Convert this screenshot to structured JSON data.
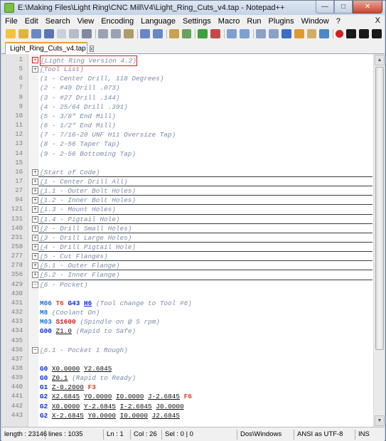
{
  "window": {
    "title": "E:\\Making Files\\Light Ring\\CNC Mill\\V4\\Light_Ring_Cuts_v4.tap - Notepad++",
    "minimize": "—",
    "maximize": "□",
    "close": "✕"
  },
  "menu": {
    "items": [
      "File",
      "Edit",
      "Search",
      "View",
      "Encoding",
      "Language",
      "Settings",
      "Macro",
      "Run",
      "Plugins",
      "Window",
      "?"
    ],
    "close_glyph": "X"
  },
  "toolbar": {
    "icons": [
      "new-file-icon",
      "open-file-icon",
      "save-icon",
      "save-all-icon",
      "close-icon",
      "close-all-icon",
      "print-icon",
      "cut-icon",
      "copy-icon",
      "paste-icon",
      "undo-icon",
      "redo-icon",
      "find-icon",
      "replace-icon",
      "zoom-in-icon",
      "zoom-out-icon",
      "sync-v-icon",
      "sync-h-icon",
      "wrap-icon",
      "all-chars-icon",
      "indent-guide-icon",
      "udl-icon",
      "doc-map-icon",
      "function-list-icon",
      "record-macro-icon",
      "stop-macro-icon",
      "play-macro-icon",
      "play-multiple-icon"
    ],
    "colors": [
      "#f4c242",
      "#e3b23c",
      "#6a86c4",
      "#5a76b4",
      "#c9d0dc",
      "#b4bcc9",
      "#7f8aa0",
      "#9aa3b3",
      "#9aa3b3",
      "#b09c6a",
      "#6a86c4",
      "#6a86c4",
      "#c9a24a",
      "#6aa060",
      "#3f9f3f",
      "#c44a4a",
      "#7f9fd0",
      "#7f9fd0",
      "#8aa0c8",
      "#8aa0c8",
      "#3c6ec4",
      "#e09a30",
      "#d0b060",
      "#4a88c8",
      "#d22020",
      "#1a1a1a",
      "#1a1a1a",
      "#1a1a1a"
    ]
  },
  "tab": {
    "label": "Light_Ring_Cuts_v4.tap",
    "close": "x"
  },
  "editor": {
    "lines": [
      {
        "n": "1",
        "fold": "red",
        "segs": [
          {
            "c": "cm-u",
            "t": "("
          },
          {
            "c": "cm",
            "t": "Light Ring Version 4.2)"
          }
        ],
        "box": true
      },
      {
        "n": "5",
        "fold": "plus",
        "segs": [
          {
            "c": "cm-u",
            "t": "("
          },
          {
            "c": "cm",
            "t": "Tool List)"
          }
        ]
      },
      {
        "n": "6",
        "segs": [
          {
            "c": "cm",
            "t": "(1 - Center Drill, 118 Degrees)"
          }
        ]
      },
      {
        "n": "7",
        "segs": [
          {
            "c": "cm",
            "t": "(2 - #49 Drill .073)"
          }
        ]
      },
      {
        "n": "8",
        "segs": [
          {
            "c": "cm",
            "t": "(3 - #27 Drill .144)"
          }
        ]
      },
      {
        "n": "9",
        "segs": [
          {
            "c": "cm",
            "t": "(4 - 25/64 Drill .391)"
          }
        ]
      },
      {
        "n": "10",
        "segs": [
          {
            "c": "cm",
            "t": "(5 - 3/8\" End Mill)"
          }
        ]
      },
      {
        "n": "11",
        "segs": [
          {
            "c": "cm",
            "t": "(6 - 1/2\" End Mill)"
          }
        ]
      },
      {
        "n": "12",
        "segs": [
          {
            "c": "cm",
            "t": "(7 - 7/16-20 UNF H11 Oversize Tap)"
          }
        ]
      },
      {
        "n": "13",
        "segs": [
          {
            "c": "cm",
            "t": "(8 - 2-56 Taper Tap)"
          }
        ]
      },
      {
        "n": "14",
        "segs": [
          {
            "c": "cm",
            "t": "(9 - 2-56 Bottoming Tap)"
          }
        ]
      },
      {
        "n": "15",
        "segs": []
      },
      {
        "n": "16",
        "fold": "plus",
        "segs": [
          {
            "c": "cm-u",
            "t": "("
          },
          {
            "c": "cm",
            "t": "Start of Code)"
          }
        ],
        "sep": true
      },
      {
        "n": "17",
        "fold": "plus",
        "segs": [
          {
            "c": "cm-u",
            "t": "("
          },
          {
            "c": "cm",
            "t": "1 - Center Drill All)"
          }
        ],
        "sep": true
      },
      {
        "n": "27",
        "fold": "plus",
        "segs": [
          {
            "c": "cm-u",
            "t": "("
          },
          {
            "c": "cm",
            "t": "1.1 - Outer Bolt Holes)"
          }
        ],
        "sep": true
      },
      {
        "n": "94",
        "fold": "plus",
        "segs": [
          {
            "c": "cm-u",
            "t": "("
          },
          {
            "c": "cm",
            "t": "1.2 - Inner Bolt Holes)"
          }
        ],
        "sep": true
      },
      {
        "n": "121",
        "fold": "plus",
        "segs": [
          {
            "c": "cm-u",
            "t": "("
          },
          {
            "c": "cm",
            "t": "1.3 - Mount Holes)"
          }
        ],
        "sep": true
      },
      {
        "n": "131",
        "fold": "plus",
        "segs": [
          {
            "c": "cm-u",
            "t": "("
          },
          {
            "c": "cm",
            "t": "1.4 - Pigtail Hole)"
          }
        ],
        "sep": true
      },
      {
        "n": "140",
        "fold": "plus",
        "segs": [
          {
            "c": "cm-u",
            "t": "("
          },
          {
            "c": "cm",
            "t": "2 - Drill Small Holes)"
          }
        ],
        "sep": true
      },
      {
        "n": "231",
        "fold": "plus",
        "segs": [
          {
            "c": "cm-u",
            "t": "("
          },
          {
            "c": "cm",
            "t": "3 - Drill Large Holes)"
          }
        ],
        "sep": true
      },
      {
        "n": "258",
        "fold": "plus",
        "segs": [
          {
            "c": "cm-u",
            "t": "("
          },
          {
            "c": "cm",
            "t": "4 - Drill Pigtail Hole)"
          }
        ],
        "sep": true
      },
      {
        "n": "277",
        "fold": "plus",
        "segs": [
          {
            "c": "cm-u",
            "t": "("
          },
          {
            "c": "cm",
            "t": "5 - Cut Flanges)"
          }
        ],
        "sep": true
      },
      {
        "n": "278",
        "fold": "plus",
        "segs": [
          {
            "c": "cm-u",
            "t": "("
          },
          {
            "c": "cm",
            "t": "5.1 - Outer Flange)"
          }
        ],
        "sep": true
      },
      {
        "n": "356",
        "fold": "plus",
        "segs": [
          {
            "c": "cm-u",
            "t": "("
          },
          {
            "c": "cm",
            "t": "5.2 - Inner Flange)"
          }
        ],
        "sep": true
      },
      {
        "n": "429",
        "fold": "minus",
        "segs": [
          {
            "c": "cm-u",
            "t": "("
          },
          {
            "c": "cm",
            "t": "6 - Pocket)"
          }
        ]
      },
      {
        "n": "430",
        "segs": []
      },
      {
        "n": "431",
        "segs": [
          {
            "c": "kw-m",
            "t": "M06"
          },
          {
            "c": "plain",
            "t": " "
          },
          {
            "c": "kw-t",
            "t": "T6"
          },
          {
            "c": "plain",
            "t": " "
          },
          {
            "c": "kw-g",
            "t": "G43"
          },
          {
            "c": "plain",
            "t": " "
          },
          {
            "c": "kw-h",
            "t": "H6"
          },
          {
            "c": "plain",
            "t": " "
          },
          {
            "c": "cm",
            "t": "(Tool change to Tool #6)"
          }
        ]
      },
      {
        "n": "432",
        "segs": [
          {
            "c": "kw-m",
            "t": "M8"
          },
          {
            "c": "plain",
            "t": " "
          },
          {
            "c": "cm",
            "t": "(Coolant On)"
          }
        ]
      },
      {
        "n": "433",
        "segs": [
          {
            "c": "kw-m",
            "t": "M03"
          },
          {
            "c": "plain",
            "t": " "
          },
          {
            "c": "kw-s",
            "t": "S1600"
          },
          {
            "c": "plain",
            "t": " "
          },
          {
            "c": "cm",
            "t": "(Spindle on @ S rpm)"
          }
        ]
      },
      {
        "n": "434",
        "segs": [
          {
            "c": "kw-g",
            "t": "G00"
          },
          {
            "c": "plain",
            "t": " "
          },
          {
            "c": "num-u",
            "t": "Z1.0"
          },
          {
            "c": "plain",
            "t": " "
          },
          {
            "c": "cm",
            "t": "(Rapid to Safe)"
          }
        ]
      },
      {
        "n": "435",
        "segs": []
      },
      {
        "n": "436",
        "fold": "minus",
        "segs": [
          {
            "c": "cm-u",
            "t": "("
          },
          {
            "c": "cm",
            "t": "6.1 - Pocket 1 Rough)"
          }
        ]
      },
      {
        "n": "437",
        "segs": []
      },
      {
        "n": "438",
        "segs": [
          {
            "c": "kw-g",
            "t": "G0"
          },
          {
            "c": "plain",
            "t": " "
          },
          {
            "c": "num-u",
            "t": "X0.0000"
          },
          {
            "c": "plain",
            "t": " "
          },
          {
            "c": "num-u",
            "t": "Y2.6845"
          }
        ]
      },
      {
        "n": "439",
        "segs": [
          {
            "c": "kw-g",
            "t": "G0"
          },
          {
            "c": "plain",
            "t": " "
          },
          {
            "c": "num-u",
            "t": "Z0.1"
          },
          {
            "c": "plain",
            "t": " "
          },
          {
            "c": "cm",
            "t": "(Rapid to Ready)"
          }
        ]
      },
      {
        "n": "440",
        "segs": [
          {
            "c": "kw-g",
            "t": "G1"
          },
          {
            "c": "plain",
            "t": " "
          },
          {
            "c": "num-u",
            "t": "Z-0.2000"
          },
          {
            "c": "plain",
            "t": " "
          },
          {
            "c": "kw-f",
            "t": "F3"
          }
        ]
      },
      {
        "n": "441",
        "segs": [
          {
            "c": "kw-g",
            "t": "G2"
          },
          {
            "c": "plain",
            "t": " "
          },
          {
            "c": "num-u",
            "t": "X2.6845"
          },
          {
            "c": "plain",
            "t": " "
          },
          {
            "c": "num-u",
            "t": "Y0.0000"
          },
          {
            "c": "plain",
            "t": " "
          },
          {
            "c": "num-u",
            "t": "I0.0000"
          },
          {
            "c": "plain",
            "t": " "
          },
          {
            "c": "num-u",
            "t": "J-2.6845"
          },
          {
            "c": "plain",
            "t": " "
          },
          {
            "c": "kw-f",
            "t": "F6"
          }
        ]
      },
      {
        "n": "442",
        "segs": [
          {
            "c": "kw-g",
            "t": "G2"
          },
          {
            "c": "plain",
            "t": " "
          },
          {
            "c": "num-u",
            "t": "X0.0000"
          },
          {
            "c": "plain",
            "t": " "
          },
          {
            "c": "num-u",
            "t": "Y-2.6845"
          },
          {
            "c": "plain",
            "t": " "
          },
          {
            "c": "num-u",
            "t": "I-2.6845"
          },
          {
            "c": "plain",
            "t": " "
          },
          {
            "c": "num-u",
            "t": "J0.0000"
          }
        ]
      },
      {
        "n": "443",
        "segs": [
          {
            "c": "kw-g",
            "t": "G2"
          },
          {
            "c": "plain",
            "t": " "
          },
          {
            "c": "num-u",
            "t": "X-2.6845"
          },
          {
            "c": "plain",
            "t": " "
          },
          {
            "c": "num-u",
            "t": "Y0.0000"
          },
          {
            "c": "plain",
            "t": " "
          },
          {
            "c": "num-u",
            "t": "I0.0000"
          },
          {
            "c": "plain",
            "t": " "
          },
          {
            "c": "num-u",
            "t": "J2.6845"
          }
        ]
      }
    ]
  },
  "status": {
    "length": "length : 23146",
    "lines": "lines : 1035",
    "ln": "Ln : 1",
    "col": "Col : 26",
    "sel": "Sel : 0 | 0",
    "eol": "Dos\\Windows",
    "encoding": "ANSI as UTF-8",
    "mode": "INS"
  }
}
